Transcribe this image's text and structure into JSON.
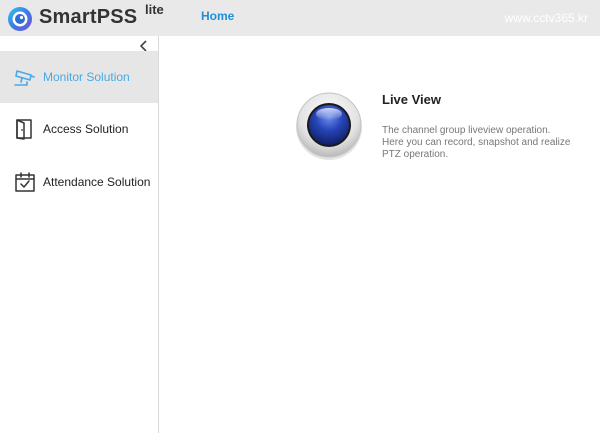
{
  "header": {
    "brand": "SmartPSS",
    "brand_sup": "lite",
    "nav_home": "Home",
    "watermark": "www.cctv365.kr"
  },
  "sidebar": {
    "items": [
      {
        "label": "Monitor Solution",
        "icon": "cctv-camera-icon",
        "active": true
      },
      {
        "label": "Access Solution",
        "icon": "door-icon",
        "active": false
      },
      {
        "label": "Attendance Solution",
        "icon": "calendar-check-icon",
        "active": false
      }
    ]
  },
  "main": {
    "card": {
      "title": "Live View",
      "description": "The channel group liveview operation. Here you can record, snapshot and realize PTZ operation."
    }
  },
  "colors": {
    "accent": "#1e90d6",
    "active_text": "#49a9e6",
    "header_bg": "#e9e9e9",
    "sidebar_active_bg": "#e6e6e6"
  }
}
